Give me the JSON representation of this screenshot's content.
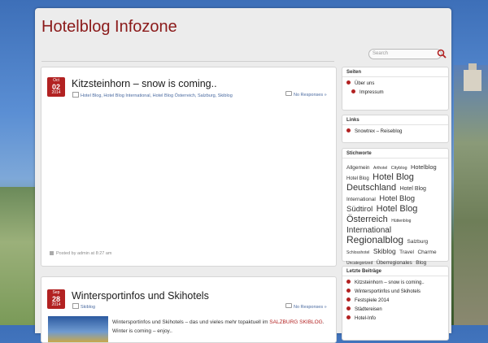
{
  "site": {
    "title": "Hotelblog Infozone"
  },
  "search": {
    "placeholder": "Search"
  },
  "posts": [
    {
      "date": {
        "month": "Oct",
        "day": "02",
        "year": "2014"
      },
      "title": "Kitzsteinhorn – snow is coming..",
      "categories": "Hotel Blog, Hotel Blog International, Hotel Blog Österreich, Salzburg, Skiblog",
      "responses": "No Responses »",
      "posted": "Posted by admin at 8:27 am"
    },
    {
      "date": {
        "month": "Sep",
        "day": "28",
        "year": "2014"
      },
      "title": "Wintersportinfos und Skihotels",
      "categories": "Skiblog",
      "responses": "No Responses »",
      "excerpt_pre": "Wintersportinfos und Skihotels – das und vieles mehr topaktuell im",
      "excerpt_link": "SALZBURG SKIBLOG",
      "excerpt_post": ". Winter is coming  –  enjoy.."
    }
  ],
  "sidebar": {
    "seiten": {
      "title": "Seiten",
      "items": [
        "Über uns",
        "Impressum"
      ]
    },
    "links": {
      "title": "Links",
      "items": [
        "Snowtrex – Reiseblog"
      ]
    },
    "stichworte": {
      "title": "Stichworte",
      "tags": [
        {
          "label": "Allgemein",
          "size": 6.5
        },
        {
          "label": "Arthotel",
          "size": 5
        },
        {
          "label": "Cityblog",
          "size": 5.5
        },
        {
          "label": "Hotelblog",
          "size": 7.5
        },
        {
          "label": "Hotel Blog",
          "size": 6
        },
        {
          "label": "Hotel Blog",
          "size": 11
        },
        {
          "label": "Deutschland",
          "size": 11
        },
        {
          "label": "Hotel Blog",
          "size": 7
        },
        {
          "label": "International",
          "size": 6.5
        },
        {
          "label": "Hotel Blog",
          "size": 9.5
        },
        {
          "label": "Südtirol",
          "size": 9.5
        },
        {
          "label": "Hotel Blog",
          "size": 11
        },
        {
          "label": "Österreich",
          "size": 11
        },
        {
          "label": "Hüttenblog",
          "size": 5
        },
        {
          "label": "International",
          "size": 10
        },
        {
          "label": "Regionalblog",
          "size": 12
        },
        {
          "label": "Salzburg",
          "size": 6.5
        },
        {
          "label": "Schlosshotel",
          "size": 5
        },
        {
          "label": "Skiblog",
          "size": 8.5
        },
        {
          "label": "Travel",
          "size": 6.5
        },
        {
          "label": "Charme",
          "size": 6.5
        },
        {
          "label": "Uncategorized",
          "size": 5
        },
        {
          "label": "Überregionales",
          "size": 6.5
        },
        {
          "label": "Blog",
          "size": 6.5
        }
      ]
    },
    "letzte": {
      "title": "Letzte Beiträge",
      "items": [
        "Kitzsteinhorn – snow is coming..",
        "Wintersportinfos und Skihotels",
        "Festspiele 2014",
        "Städtereisen",
        "Hotel-Info"
      ]
    }
  },
  "colors": {
    "accent": "#b22222",
    "title": "#8b1a1a"
  }
}
